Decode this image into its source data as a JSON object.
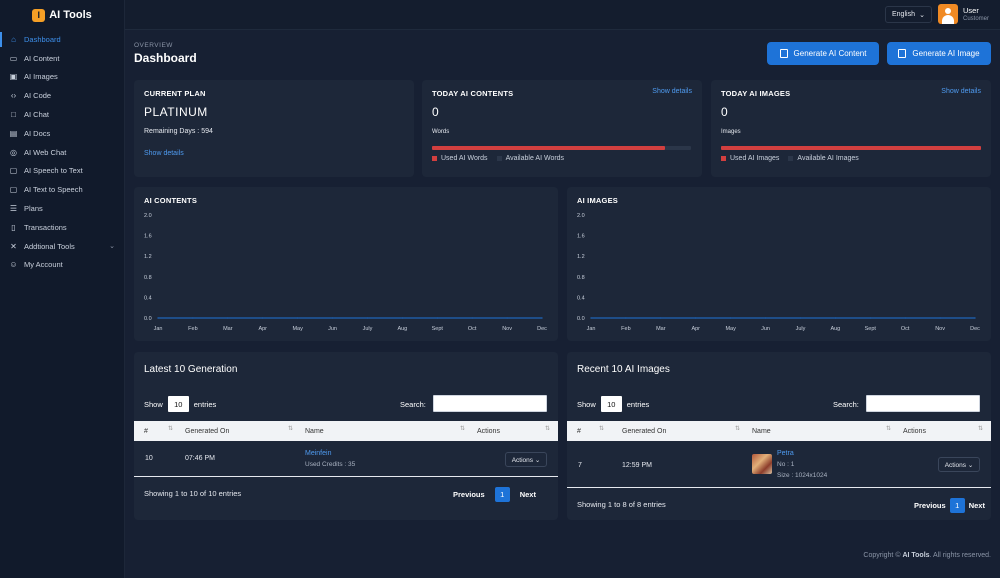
{
  "app": {
    "name": "AI Tools",
    "logo_letter": "I"
  },
  "sidebar": {
    "items": [
      {
        "label": "Dashboard",
        "icon": "home-icon"
      },
      {
        "label": "AI Content",
        "icon": "document-icon"
      },
      {
        "label": "AI Images",
        "icon": "image-icon"
      },
      {
        "label": "AI Code",
        "icon": "code-icon"
      },
      {
        "label": "AI Chat",
        "icon": "chat-icon"
      },
      {
        "label": "AI Docs",
        "icon": "docs-icon"
      },
      {
        "label": "AI Web Chat",
        "icon": "globe-icon"
      },
      {
        "label": "AI Speech to Text",
        "icon": "speech-icon"
      },
      {
        "label": "AI Text to Speech",
        "icon": "speaker-icon"
      },
      {
        "label": "Plans",
        "icon": "list-icon"
      },
      {
        "label": "Transactions",
        "icon": "receipt-icon"
      },
      {
        "label": "Addtional Tools",
        "icon": "tools-icon"
      },
      {
        "label": "My Account",
        "icon": "user-icon"
      }
    ]
  },
  "topbar": {
    "language": "English",
    "user_name": "User",
    "user_role": "Customer"
  },
  "header": {
    "overline": "OVERVIEW",
    "title": "Dashboard",
    "btn_content": "Generate AI Content",
    "btn_image": "Generate AI Image"
  },
  "plan_card": {
    "title": "CURRENT PLAN",
    "plan": "PLATINUM",
    "remaining": "Remaining Days : 594",
    "link": "Show details"
  },
  "contents_card": {
    "title": "TODAY AI CONTENTS",
    "link": "Show details",
    "count": "0",
    "label": "Words",
    "used_fraction": 0.9,
    "legend_used": "Used AI Words",
    "legend_avail": "Available AI Words"
  },
  "images_card": {
    "title": "TODAY AI IMAGES",
    "link": "Show details",
    "count": "0",
    "label": "Images",
    "used_fraction": 1.0,
    "legend_used": "Used AI Images",
    "legend_avail": "Available AI Images"
  },
  "charts": {
    "contents_title": "AI CONTENTS",
    "images_title": "AI IMAGES"
  },
  "chart_data": [
    {
      "type": "line",
      "title": "AI CONTENTS",
      "categories": [
        "Jan",
        "Feb",
        "Mar",
        "Apr",
        "May",
        "Jun",
        "July",
        "Aug",
        "Sept",
        "Oct",
        "Nov",
        "Dec"
      ],
      "values": [
        0,
        0,
        0,
        0,
        0,
        0,
        0,
        0,
        0,
        0,
        0,
        0
      ],
      "yticks": [
        "2.0",
        "1.6",
        "1.2",
        "0.8",
        "0.4",
        "0.0"
      ],
      "ylim": [
        0,
        2
      ],
      "grid": false
    },
    {
      "type": "line",
      "title": "AI IMAGES",
      "categories": [
        "Jan",
        "Feb",
        "Mar",
        "Apr",
        "May",
        "Jun",
        "July",
        "Aug",
        "Sept",
        "Oct",
        "Nov",
        "Dec"
      ],
      "values": [
        0,
        0,
        0,
        0,
        0,
        0,
        0,
        0,
        0,
        0,
        0,
        0
      ],
      "yticks": [
        "2.0",
        "1.6",
        "1.2",
        "0.8",
        "0.4",
        "0.0"
      ],
      "ylim": [
        0,
        2
      ],
      "grid": false
    }
  ],
  "generations": {
    "title": "Latest 10 Generation",
    "show": "Show",
    "page_size": "10",
    "entries": "entries",
    "search": "Search:",
    "columns": [
      "#",
      "Generated On",
      "Name",
      "Actions"
    ],
    "row": {
      "num": "10",
      "time": "07:46 PM",
      "name": "Meinfein",
      "meta": "Used Credits : 35",
      "actions": "Actions ⌄"
    },
    "info": "Showing 1 to 10 of 10 entries",
    "prev": "Previous",
    "page": "1",
    "next": "Next"
  },
  "images": {
    "title": "Recent 10 AI Images",
    "show": "Show",
    "page_size": "10",
    "entries": "entries",
    "search": "Search:",
    "columns": [
      "#",
      "Generated On",
      "Name",
      "Actions"
    ],
    "row": {
      "num": "7",
      "time": "12:59 PM",
      "name": "Petra",
      "no": "No : 1",
      "size": "Size : 1024x1024",
      "actions": "Actions ⌄"
    },
    "info": "Showing 1 to 8 of 8 entries",
    "prev": "Previous",
    "page": "1",
    "next": "Next"
  },
  "footer": {
    "prefix": "Copyright ©",
    "brand": "AI Tools",
    "suffix": ". All rights reserved."
  },
  "colors": {
    "accent": "#1e73d8",
    "used": "#d23f3f",
    "logo": "#f59f26"
  }
}
